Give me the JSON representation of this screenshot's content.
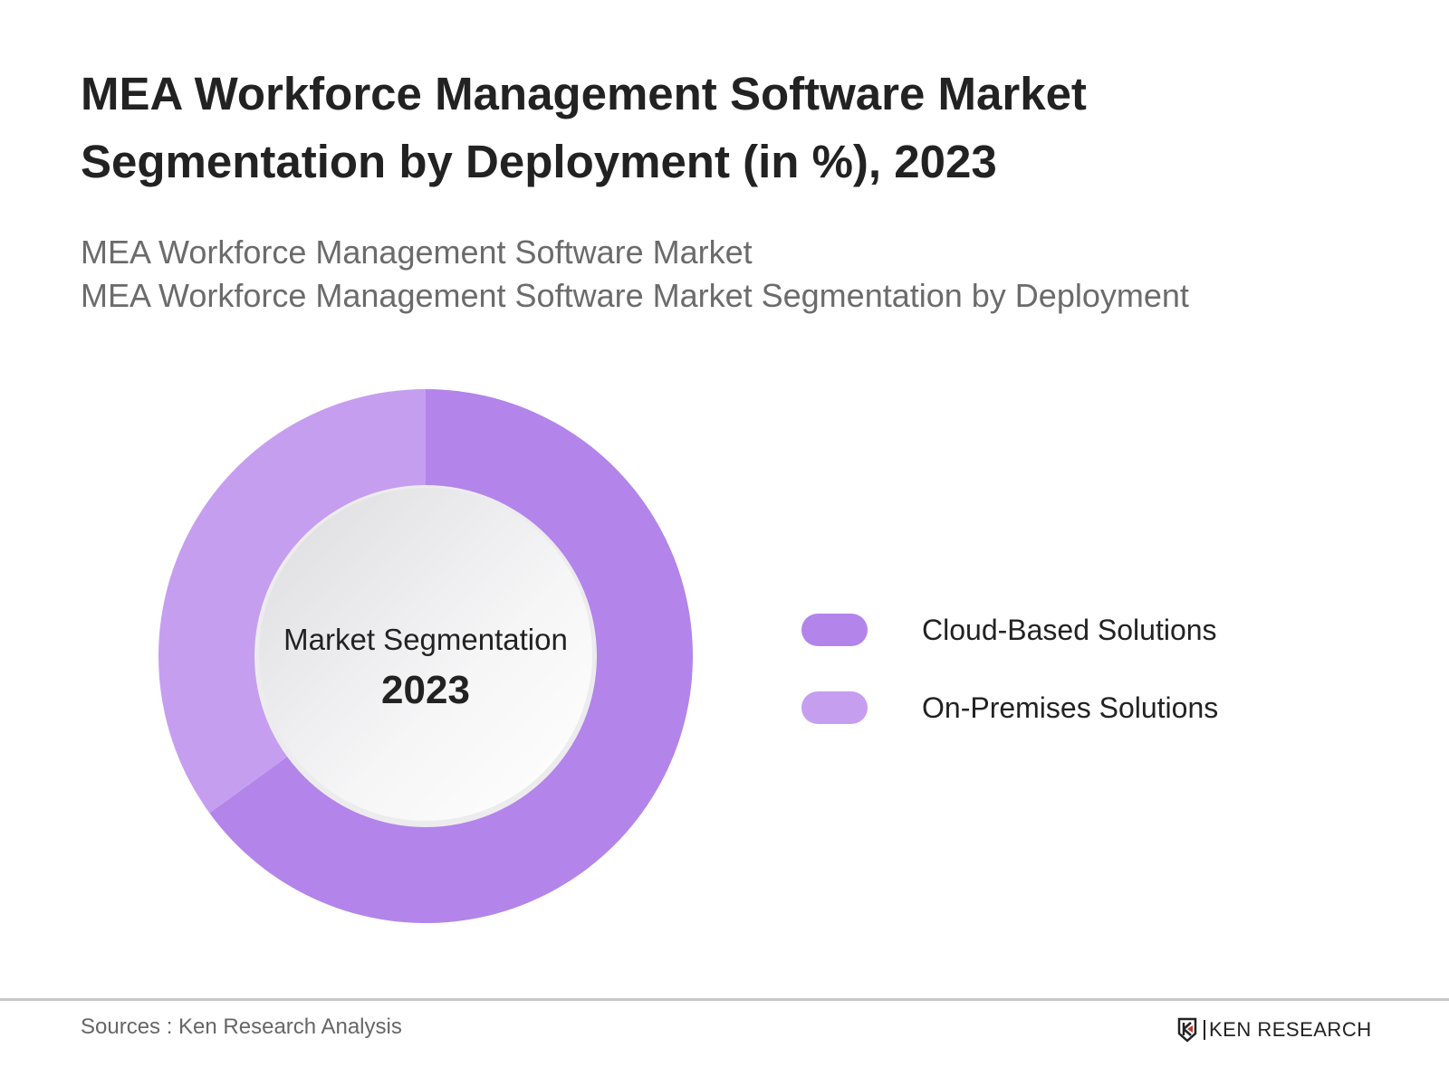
{
  "header": {
    "title_line1": "MEA Workforce Management Software Market",
    "title_line2": "Segmentation by Deployment (in %), 2023",
    "subtitle_line1": "MEA Workforce Management Software Market",
    "subtitle_line2": "MEA Workforce Management Software Market Segmentation by Deployment"
  },
  "chart_data": {
    "type": "pie",
    "variant": "donut",
    "categories": [
      "Cloud-Based Solutions",
      "On-Premises Solutions"
    ],
    "values": [
      65,
      35
    ],
    "colors": [
      "#b384ea",
      "#c69ef0"
    ],
    "center_label": "Market Segmentation",
    "center_year": "2023",
    "legend_position": "right",
    "data_labels": false
  },
  "footer": {
    "sources": "Sources : Ken Research Analysis",
    "logo_text": "KEN RESEARCH"
  }
}
